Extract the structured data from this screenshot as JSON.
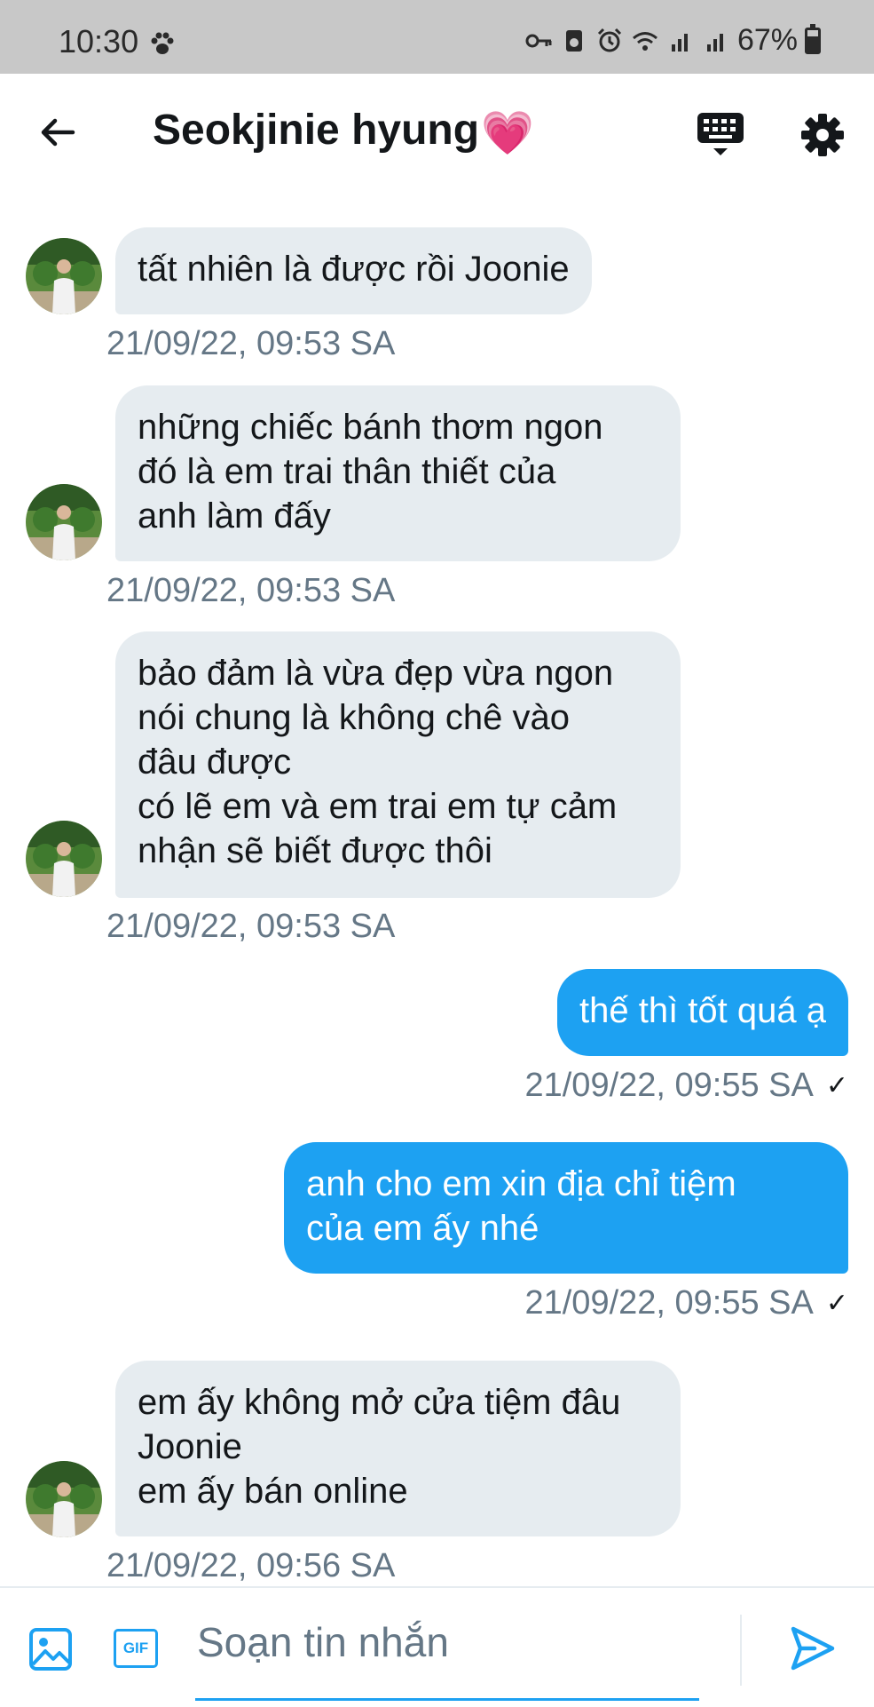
{
  "status_bar": {
    "time": "10:30",
    "battery": "67%",
    "battery_level": 0.67
  },
  "header": {
    "title": "Seokjinie hyung",
    "title_emoji": "💗"
  },
  "messages": [
    {
      "direction": "in",
      "text": "tất nhiên là được rồi Joonie",
      "timestamp": "21/09/22, 09:53 SA"
    },
    {
      "direction": "in",
      "text": "những chiếc bánh thơm ngon\nđó là em trai thân thiết của\nanh làm đấy",
      "timestamp": "21/09/22, 09:53 SA"
    },
    {
      "direction": "in",
      "text": "bảo đảm là vừa đẹp vừa ngon\nnói chung là không chê vào\nđâu được\ncó lẽ em và em trai em tự cảm\nnhận sẽ biết được thôi",
      "timestamp": "21/09/22, 09:53 SA"
    },
    {
      "direction": "out",
      "text": "thế thì tốt quá ạ",
      "timestamp": "21/09/22, 09:55 SA",
      "status": "✓"
    },
    {
      "direction": "out",
      "text": "anh cho em xin địa chỉ tiệm\ncủa em ấy nhé",
      "timestamp": "21/09/22, 09:55 SA",
      "status": "✓"
    },
    {
      "direction": "in",
      "text": "em ấy không mở cửa tiệm đâu\nJoonie\nem ấy bán online",
      "timestamp": "21/09/22, 09:56 SA"
    }
  ],
  "composer": {
    "placeholder": "Soạn tin nhắn",
    "gif_label": "GIF"
  },
  "colors": {
    "accent": "#1da1f2",
    "incoming_bubble": "#e6ecf0",
    "timestamp": "#657786"
  }
}
